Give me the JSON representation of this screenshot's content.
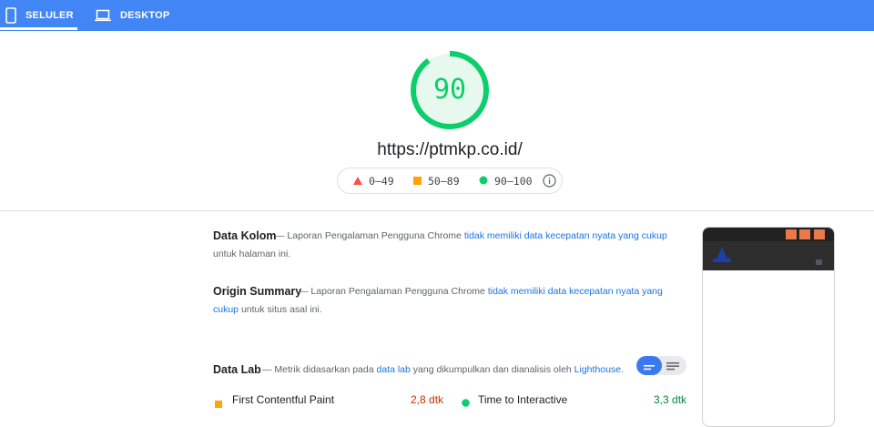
{
  "tabs": [
    {
      "label": "SELULER",
      "icon": "smartphone-icon",
      "active": true
    },
    {
      "label": "DESKTOP",
      "icon": "laptop-icon",
      "active": false
    }
  ],
  "score": {
    "value": "90",
    "fraction": 0.9,
    "color": "#0cce6b"
  },
  "url": "https://ptmkp.co.id/",
  "legend": [
    {
      "range": "0–49",
      "icon": "red-triangle-icon",
      "color": "#ff4e42"
    },
    {
      "range": "50–89",
      "icon": "orange-square-icon",
      "color": "#ffa400"
    },
    {
      "range": "90–100",
      "icon": "green-circle-icon",
      "color": "#0cce6b"
    }
  ],
  "sections": {
    "field": {
      "title": "Data Kolom",
      "dash": "—",
      "prefix": "Laporan Pengalaman Pengguna Chrome",
      "link": "tidak memiliki data kecepatan nyata yang cukup",
      "suffix": "untuk halaman ini."
    },
    "origin": {
      "title": "Origin Summary",
      "dash": "—",
      "prefix": "Laporan Pengalaman Pengguna Chrome",
      "link": "tidak memiliki data kecepatan nyata yang cukup",
      "suffix": "untuk situs asal ini."
    },
    "lab": {
      "title": "Data Lab",
      "dash": "—",
      "prefix": "Metrik didasarkan pada",
      "link1": "data lab",
      "middle": "yang dikumpulkan dan dianalisis oleh",
      "link2": "Lighthouse",
      "end": "."
    }
  },
  "metrics": [
    {
      "label": "First Contentful Paint",
      "value": "2,8 dtk",
      "status": "orange",
      "color": "#c33300"
    },
    {
      "label": "Time to Interactive",
      "value": "3,3 dtk",
      "status": "green",
      "color": "#018642"
    }
  ],
  "view_toggle": {
    "active": "summary-view-icon",
    "inactive": "list-view-icon"
  }
}
